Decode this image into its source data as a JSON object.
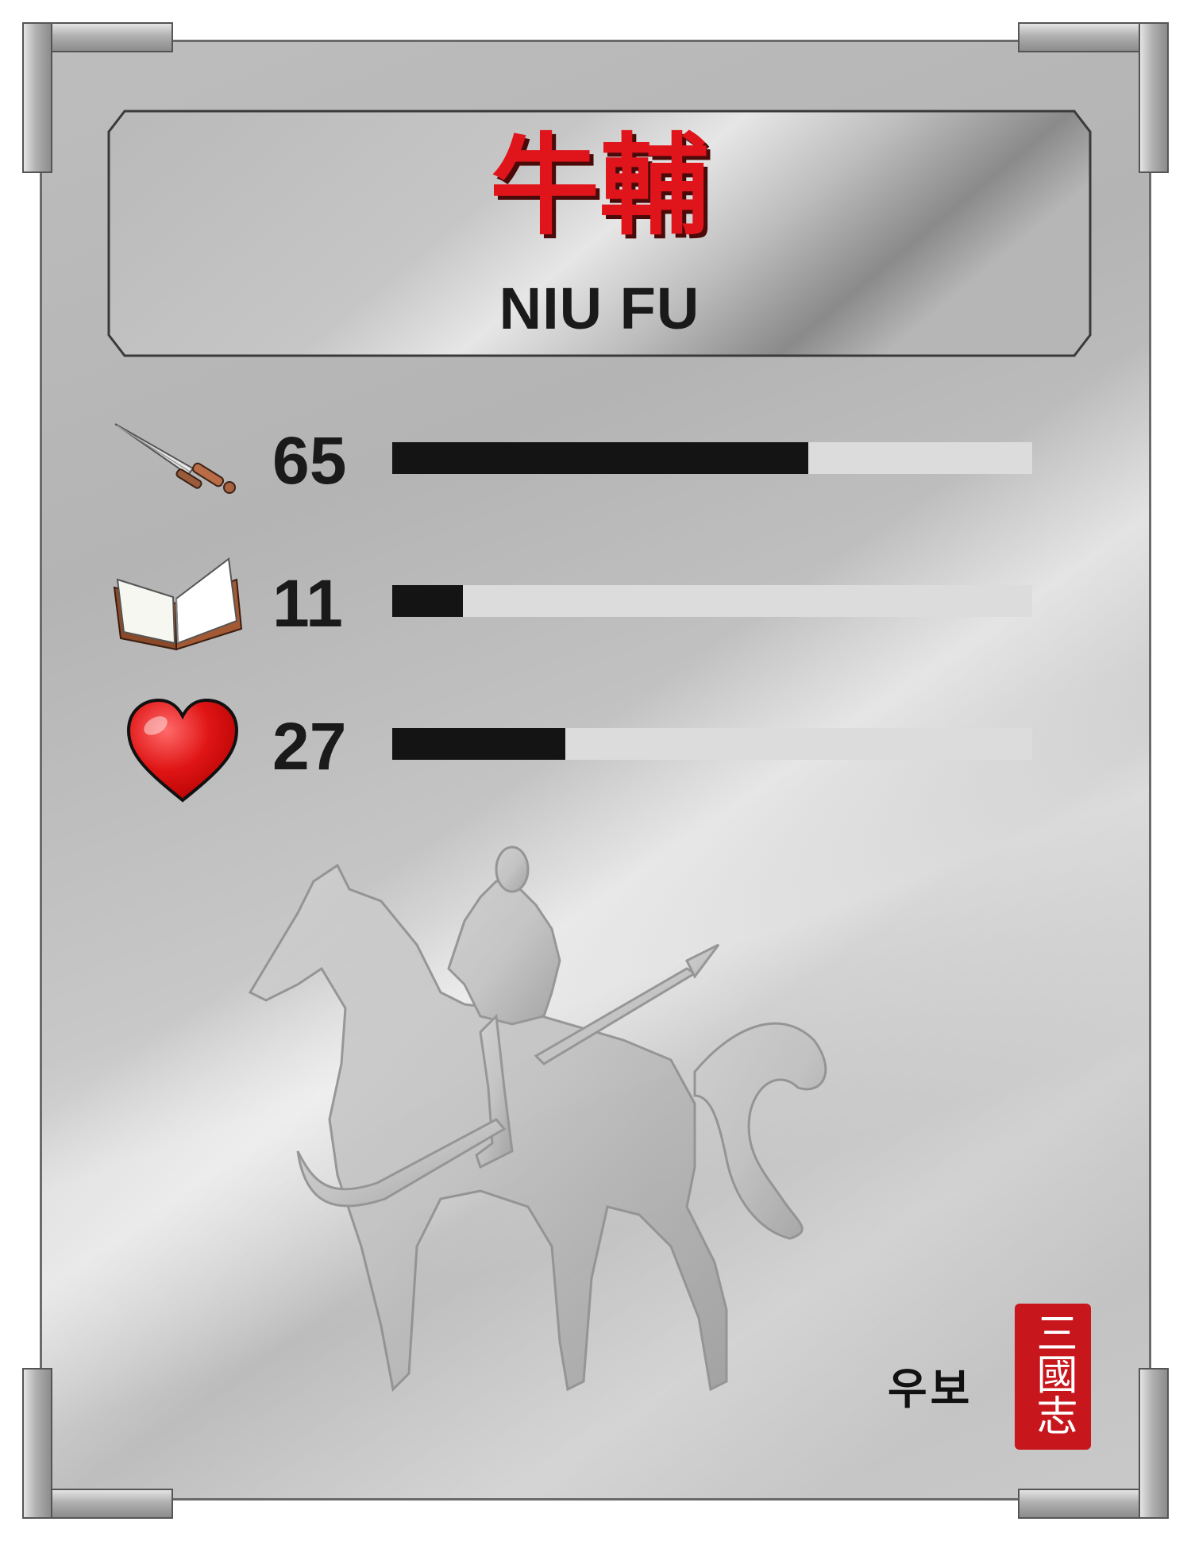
{
  "character": {
    "name_cjk": "牛輔",
    "name_latin": "NIU FU",
    "name_korean": "우보"
  },
  "stats": [
    {
      "icon": "sword-icon",
      "value": "65",
      "fraction": 0.65
    },
    {
      "icon": "book-icon",
      "value": "11",
      "fraction": 0.11
    },
    {
      "icon": "heart-icon",
      "value": "27",
      "fraction": 0.27
    }
  ],
  "seal": {
    "text": "三國志"
  },
  "colors": {
    "name_red": "#e0141b",
    "bar_fill": "#141414",
    "bar_track": "#dcdcdc",
    "seal_red": "#c8161d",
    "frame_silver": "#bdbdbd"
  },
  "artwork": {
    "icon": "horse-rider-silhouette-icon"
  }
}
